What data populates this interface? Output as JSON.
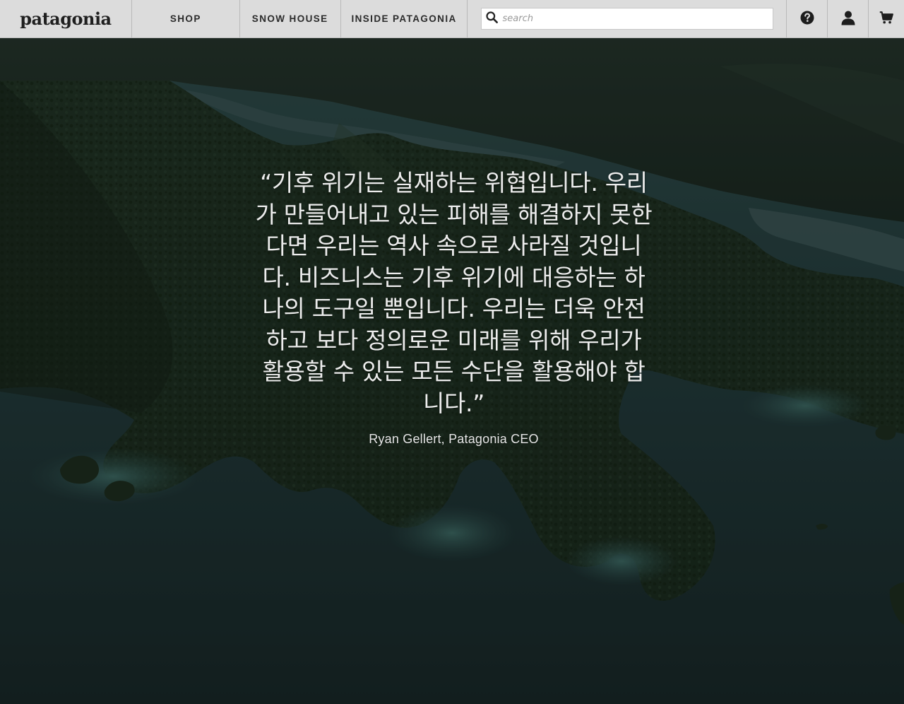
{
  "header": {
    "logo": "patagonia",
    "nav": [
      {
        "label": "SHOP"
      },
      {
        "label": "SNOW HOUSE"
      },
      {
        "label": "INSIDE PATAGONIA"
      }
    ],
    "search": {
      "placeholder": "search",
      "value": "",
      "icon": "search-icon"
    },
    "icons": [
      "help-icon",
      "account-icon",
      "cart-icon"
    ]
  },
  "hero": {
    "quote": "“기후 위기는 실재하는 위협입니다. 우리가 만들어내고 있는 피해를 해결하지 못한다면 우리는 역사 속으로 사라질 것입니다. 비즈니스는 기후 위기에 대응하는 하나의 도구일 뿐입니다. 우리는 더욱 안전하고 보다 정의로운 미래를 위해 우리가 활용할 수 있는 모든 수단을 활용해야 합니다.”",
    "attribution": "Ryan Gellert, Patagonia CEO"
  }
}
